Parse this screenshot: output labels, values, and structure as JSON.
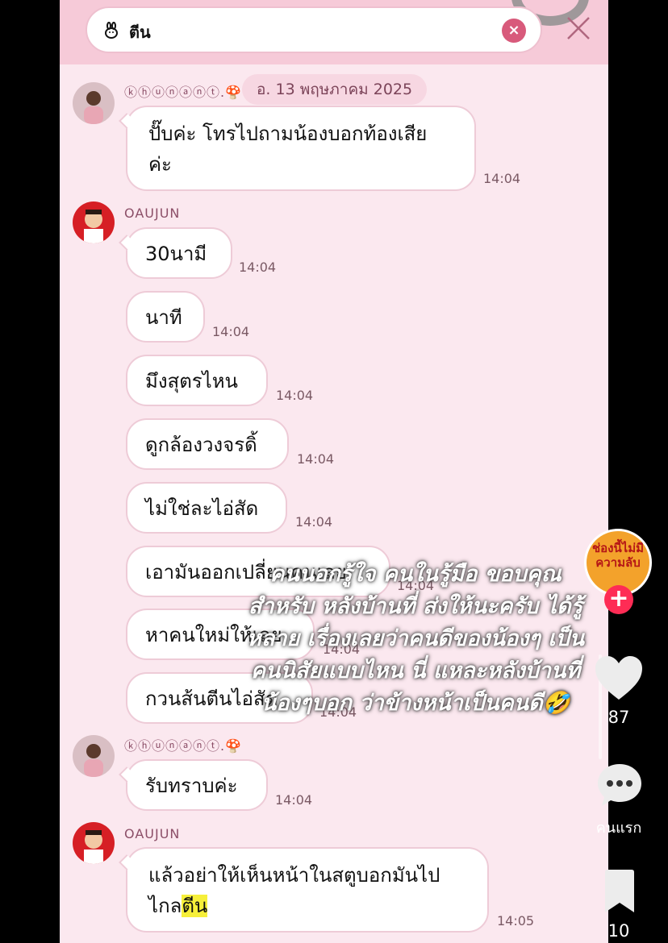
{
  "search": {
    "query": "ตีน",
    "clear_label": "×"
  },
  "chat": {
    "date": "อ. 13 พฤษภาคม 2025",
    "blocks": [
      {
        "sender": "ⓚⓗⓤⓝⓐⓝⓣ.🍄",
        "messages": [
          {
            "text": "ปั๊บค่ะ โทรไปถามน้องบอกท้องเสีย ค่ะ",
            "time": "14:04"
          }
        ]
      },
      {
        "sender": "OAUJUN",
        "messages": [
          {
            "text": "30นามี",
            "time": "14:04"
          },
          {
            "text": "นาที",
            "time": "14:04"
          },
          {
            "text": "มึงสุตรไหน",
            "time": "14:04"
          },
          {
            "text": "ดูกล้องวงจรดิ้",
            "time": "14:04"
          },
          {
            "text": "ไม่ใช่ละไอ่สัด",
            "time": "14:04"
          },
          {
            "text": "เอามันออกเปลี่ยนคนเลย",
            "time": "14:04"
          },
          {
            "text": "หาคนใหม่ให้เลย",
            "time": "14:04"
          },
          {
            "text": "กวนส้นตีนไอ่สัด",
            "time": "14:04"
          }
        ]
      },
      {
        "sender": "ⓚⓗⓤⓝⓐⓝⓣ.🍄",
        "messages": [
          {
            "text": "รับทราบค่ะ",
            "time": "14:04"
          }
        ]
      },
      {
        "sender": "OAUJUN",
        "messages": [
          {
            "text_before": "แล้วอย่าให้เห็นหน้าในสตูบอกมันไป ไกล",
            "highlight": "ตีน",
            "time": "14:05"
          }
        ]
      }
    ]
  },
  "overlay_caption": "คนนอกรู้ใจ คนในรู้มือ ขอบคุณสำหรับ หลังบ้านที่ ส่งให้นะครับ ได้รู้หลาย เรื่องเลยว่าคนดีของน้องๆ เป็นคนนิสัยแบบไหน นี่ แหละหลังบ้านที่น้องๆบอก ว่าข้างหน้าเป็นคนดี🤣",
  "sidebar": {
    "creator_badge_text": "ช่องนี้ไม่มีความลับ",
    "follow_label": "+",
    "like_count": "87",
    "comment_label": "คนแรก",
    "bookmark_count": "10"
  },
  "colors": {
    "chat_bg": "#fbe8ef",
    "header_bg": "#f6cad8",
    "accent": "#fe2c55",
    "highlight": "#f6ef3a"
  }
}
